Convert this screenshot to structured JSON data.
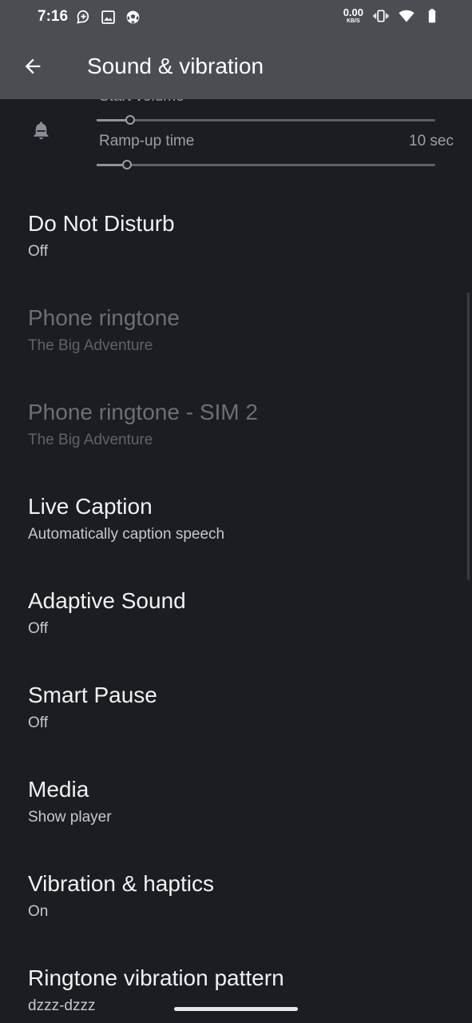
{
  "status_bar": {
    "time": "7:16",
    "net_speed_value": "0.00",
    "net_speed_unit": "KB/S",
    "left_icons": [
      "chat-plus-icon",
      "image-icon",
      "soccer-ball-icon"
    ],
    "right_icons": [
      "vibrate-icon",
      "wifi-icon",
      "battery-icon"
    ]
  },
  "app_bar": {
    "title": "Sound & vibration",
    "back_icon": "arrow-back-icon"
  },
  "ringer_ramp": {
    "start_volume_label": "Start volume",
    "start_volume_level": 0.1,
    "ramp_label": "Ramp-up time",
    "ramp_value": "10 sec",
    "ramp_level": 0.09
  },
  "preferences": [
    {
      "title": "Do Not Disturb",
      "summary": "Off",
      "enabled": true
    },
    {
      "title": "Phone ringtone",
      "summary": "The Big Adventure",
      "enabled": false
    },
    {
      "title": "Phone ringtone - SIM 2",
      "summary": "The Big Adventure",
      "enabled": false
    },
    {
      "title": "Live Caption",
      "summary": "Automatically caption speech",
      "enabled": true
    },
    {
      "title": "Adaptive Sound",
      "summary": "Off",
      "enabled": true
    },
    {
      "title": "Smart Pause",
      "summary": "Off",
      "enabled": true
    },
    {
      "title": "Media",
      "summary": "Show player",
      "enabled": true
    },
    {
      "title": "Vibration & haptics",
      "summary": "On",
      "enabled": true
    },
    {
      "title": "Ringtone vibration pattern",
      "summary": "dzzz-dzzz",
      "enabled": true
    }
  ],
  "colors": {
    "background": "#1b1d22",
    "header": "#4a4d52",
    "text_primary": "#f1f1f1",
    "text_disabled": "#6c7076"
  }
}
